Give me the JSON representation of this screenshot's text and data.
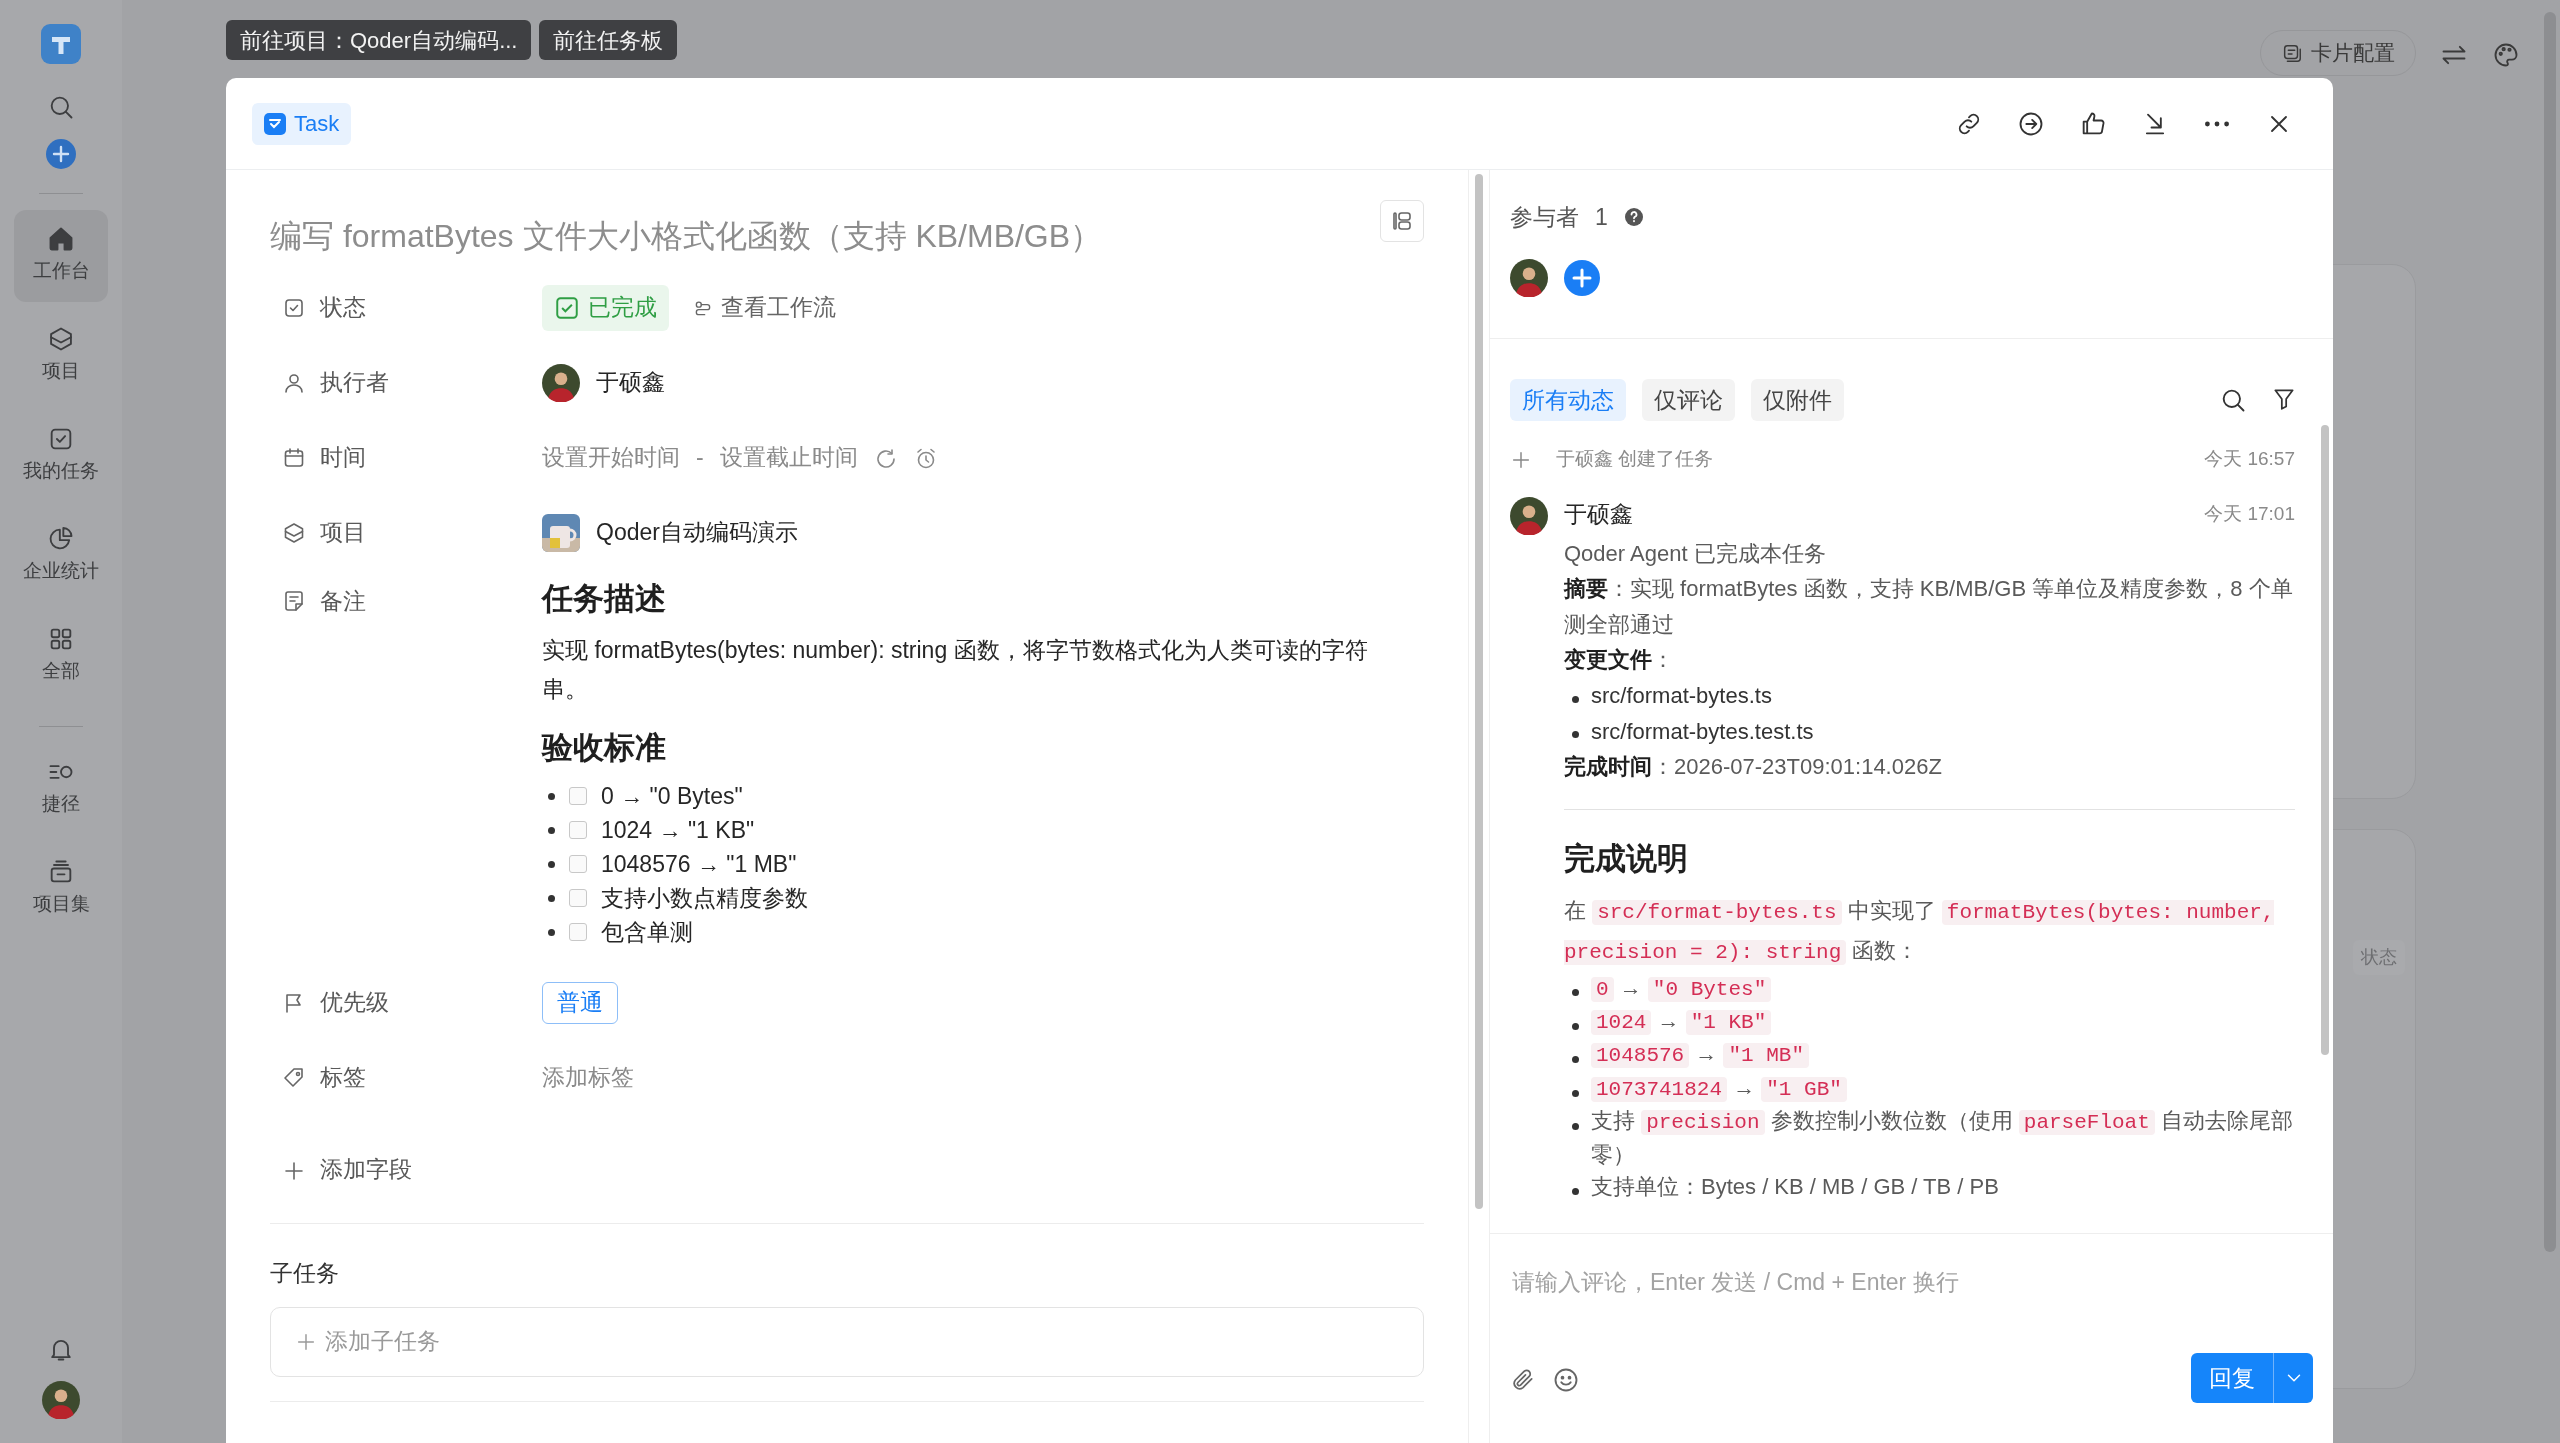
{
  "sidebar": {
    "items": [
      {
        "label": "工作台",
        "selected": true
      },
      {
        "label": "项目",
        "selected": false
      },
      {
        "label": "我的任务",
        "selected": false
      },
      {
        "label": "企业统计",
        "selected": false
      },
      {
        "label": "全部",
        "selected": false
      },
      {
        "label": "捷径",
        "selected": false
      },
      {
        "label": "项目集",
        "selected": false
      }
    ]
  },
  "background": {
    "card_config": "卡片配置",
    "card_chip": "状态"
  },
  "top_buttons": [
    "前往项目：Qoder自动编码...",
    "前往任务板"
  ],
  "modal": {
    "type_chip": "Task",
    "title": "编写 formatBytes 文件大小格式化函数（支持 KB/MB/GB）",
    "fields": [
      {
        "kind": "status",
        "label": "状态",
        "value": "已完成",
        "link": "查看工作流"
      },
      {
        "kind": "person",
        "label": "执行者",
        "value": "于硕鑫"
      },
      {
        "kind": "time",
        "label": "时间",
        "start": "设置开始时间",
        "separator": "-",
        "end": "设置截止时间"
      },
      {
        "kind": "project",
        "label": "项目",
        "value": "Qoder自动编码演示"
      },
      {
        "kind": "notes",
        "label": "备注",
        "heading": "任务描述",
        "paragraph": "实现 formatBytes(bytes: number): string 函数，将字节数格式化为人类可读的字符串。",
        "heading_2": "验收标准",
        "checklist": [
          {
            "text": "0 → \"0 Bytes\"",
            "checked": false
          },
          {
            "text": "1024 → \"1 KB\"",
            "checked": false
          },
          {
            "text": "1048576 → \"1 MB\"",
            "checked": false
          },
          {
            "text": "支持小数点精度参数",
            "checked": false
          },
          {
            "text": "包含单测",
            "checked": false
          }
        ]
      },
      {
        "kind": "priority",
        "label": "优先级",
        "value": "普通"
      },
      {
        "kind": "tags",
        "label": "标签",
        "value": "添加标签"
      }
    ],
    "add_field": "添加字段",
    "subtasks": {
      "title": "子任务",
      "add": "添加子任务"
    },
    "participants": {
      "label": "参与者",
      "count": "1"
    },
    "tabs": [
      {
        "label": "所有动态",
        "selected": true
      },
      {
        "label": "仅评论",
        "selected": false
      },
      {
        "label": "仅附件",
        "selected": false
      }
    ],
    "activity": [
      {
        "kind": "event",
        "text": "于硕鑫 创建了任务",
        "time": "今天 16:57"
      },
      {
        "kind": "comment",
        "author": "于硕鑫",
        "time": "今天 17:01",
        "blocks": [
          {
            "kind": "p",
            "text": "Qoder Agent 已完成本任务"
          },
          {
            "kind": "p",
            "text": "**摘要**：实现 formatBytes 函数，支持 KB/MB/GB 等单位及精度参数，8 个单测全部通过"
          },
          {
            "kind": "p",
            "text": "**变更文件**："
          },
          {
            "kind": "ul",
            "items": [
              "src/format-bytes.ts",
              "src/format-bytes.test.ts"
            ]
          },
          {
            "kind": "p",
            "text": "**完成时间**：2026-07-23T09:01:14.026Z"
          },
          {
            "kind": "hr"
          },
          {
            "kind": "h",
            "text": "完成说明"
          },
          {
            "kind": "segments",
            "segments": [
              {
                "kind": "text",
                "text": "在 "
              },
              {
                "kind": "code",
                "text": "src/format-bytes.ts"
              },
              {
                "kind": "text",
                "text": " 中实现了 "
              },
              {
                "kind": "code",
                "text": "formatBytes(bytes: number, precision = 2): string"
              },
              {
                "kind": "text",
                "text": " 函数："
              }
            ]
          },
          {
            "kind": "seglist",
            "items": [
              [
                {
                  "kind": "code",
                  "text": "0"
                },
                {
                  "kind": "text",
                  "text": " → "
                },
                {
                  "kind": "code",
                  "text": "\"0 Bytes\""
                }
              ],
              [
                {
                  "kind": "code",
                  "text": "1024"
                },
                {
                  "kind": "text",
                  "text": " → "
                },
                {
                  "kind": "code",
                  "text": "\"1 KB\""
                }
              ],
              [
                {
                  "kind": "code",
                  "text": "1048576"
                },
                {
                  "kind": "text",
                  "text": " → "
                },
                {
                  "kind": "code",
                  "text": "\"1 MB\""
                }
              ],
              [
                {
                  "kind": "code",
                  "text": "1073741824"
                },
                {
                  "kind": "text",
                  "text": " → "
                },
                {
                  "kind": "code",
                  "text": "\"1 GB\""
                }
              ],
              [
                {
                  "kind": "text",
                  "text": "支持 "
                },
                {
                  "kind": "code",
                  "text": "precision"
                },
                {
                  "kind": "text",
                  "text": " 参数控制小数位数（使用 "
                },
                {
                  "kind": "code",
                  "text": "parseFloat"
                },
                {
                  "kind": "text",
                  "text": " 自动去除尾部零）"
                }
              ],
              [
                {
                  "kind": "text",
                  "text": "支持单位：Bytes / KB / MB / GB / TB / PB"
                }
              ]
            ]
          }
        ]
      }
    ],
    "comment_box": {
      "placeholder": "请输入评论，Enter 发送 / Cmd + Enter 换行",
      "reply": "回复"
    }
  }
}
